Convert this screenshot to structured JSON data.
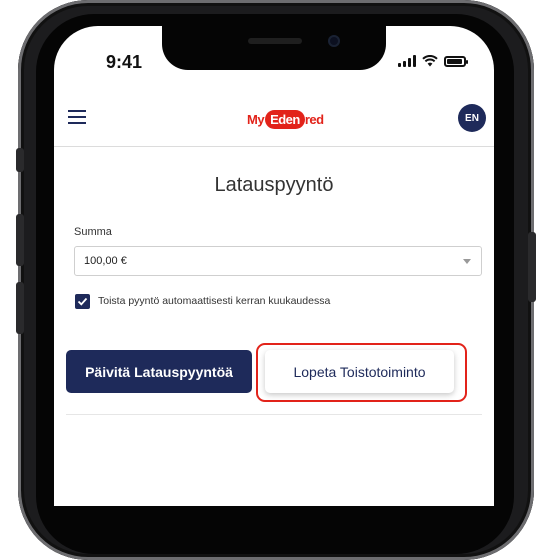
{
  "status_bar": {
    "time": "9:41"
  },
  "header": {
    "logo": {
      "part1": "My",
      "part2": "Eden",
      "part3": "red"
    },
    "language": "EN"
  },
  "page": {
    "title": "Latauspyyntö"
  },
  "form": {
    "amount_label": "Summa",
    "amount_value": "100,00 €",
    "repeat_checkbox_label": "Toista pyyntö automaattisesti kerran kuukaudessa",
    "repeat_checked": true
  },
  "actions": {
    "update_label": "Päivitä Latauspyyntöä",
    "stop_repeat_label": "Lopeta Toistotoiminto"
  },
  "colors": {
    "brand_navy": "#1e2a5a",
    "brand_red": "#e2231a"
  }
}
